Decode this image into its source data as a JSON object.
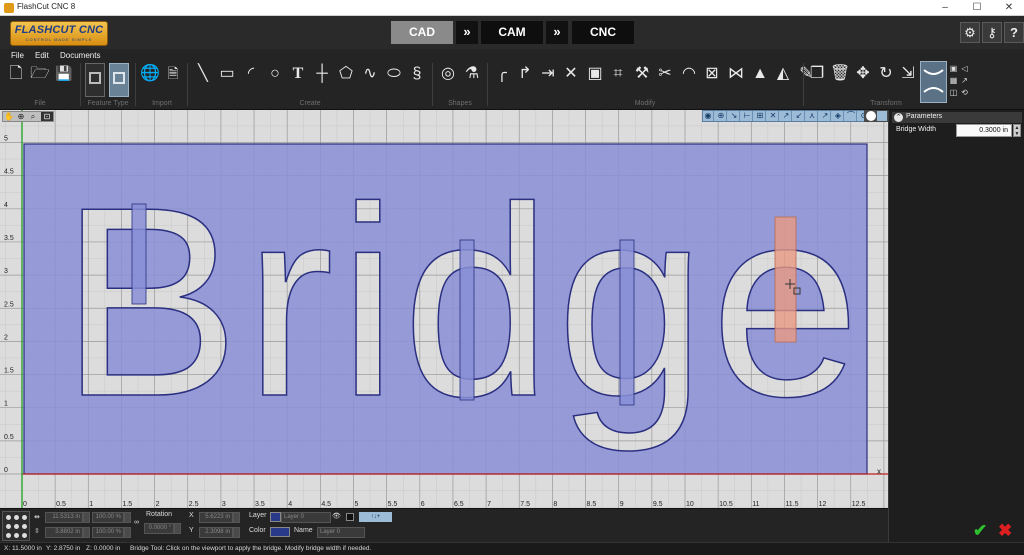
{
  "window": {
    "title": "FlashCut CNC 8",
    "minimize": "–",
    "maximize": "☐",
    "close": "✕"
  },
  "header": {
    "logo_text": "FLASHCUT CNC",
    "logo_tagline": "CONTROL MADE SIMPLE",
    "modes": [
      "CAD",
      "CAM",
      "CNC"
    ],
    "active_mode": "CAD",
    "arrow_glyph": "»",
    "icons": [
      "settings-gear-icon",
      "key-icon",
      "help-icon"
    ]
  },
  "menu": [
    "File",
    "Edit",
    "Documents"
  ],
  "ribbon_groups": {
    "file": "File",
    "feature_type": "Feature Type",
    "import": "Import",
    "create": "Create",
    "shapes": "Shapes",
    "modify": "Modify",
    "transform": "Transform"
  },
  "ribbon_icons": {
    "file": [
      "new-file-icon",
      "open-folder-icon",
      "save-icon"
    ],
    "feature_type": [
      "feature-type-cut-icon",
      "feature-type-selected-icon"
    ],
    "import": [
      "globe-import-icon",
      "file-import-icon"
    ],
    "create": [
      "line-icon",
      "rectangle-icon",
      "arc-icon",
      "circle-icon",
      "text-icon",
      "point-icon",
      "polygon-icon",
      "spline-icon",
      "ellipse-icon",
      "spiral-icon"
    ],
    "shapes": [
      "shape-library-icon",
      "shape-tool-icon"
    ],
    "modify": [
      "fillet-icon",
      "chamfer-icon",
      "extend-icon",
      "trim-icon",
      "image-icon",
      "node-edit-icon",
      "tab-icon",
      "scissors-icon",
      "offset-icon",
      "bridge-icon",
      "join-icon",
      "stamp-icon",
      "gradient-icon",
      "weld-icon"
    ],
    "transform": [
      "copy-icon",
      "delete-icon",
      "move-icon",
      "rotate-icon",
      "mirror-icon",
      "bridge-transform-selected-icon"
    ]
  },
  "canvas": {
    "x_ticks": [
      "0",
      "0.5",
      "1",
      "1.5",
      "2",
      "2.5",
      "3",
      "3.5",
      "4",
      "4.5",
      "5",
      "5.5",
      "6",
      "6.5",
      "7",
      "7.5",
      "8",
      "8.5",
      "9",
      "9.5",
      "10",
      "10.5",
      "11",
      "11.5",
      "12",
      "12.5"
    ],
    "y_ticks": [
      "0",
      "0.5",
      "1",
      "1.5",
      "2",
      "2.5",
      "3",
      "3.5",
      "4",
      "4.5",
      "5"
    ],
    "text_shape": "Bridge",
    "axis_x_end_label": "x",
    "colors": {
      "background": "#dcdcdc",
      "minor_grid": "#c8c8c8",
      "major_grid": "#9a9a9a",
      "stock_fill": "#8a8fd6",
      "stock_stroke": "#2a2f80",
      "bridge_fill": "#e89a82",
      "x_axis": "#c02020",
      "y_axis": "#20a020"
    }
  },
  "snap_tools": [
    "snap-grid-icon",
    "snap-center-icon",
    "snap-endpoint-icon",
    "snap-midpoint-icon",
    "snap-intersection-icon",
    "snap-perpendicular-icon",
    "snap-tangent-icon",
    "snap-nearest-icon",
    "snap-quadrant-icon",
    "snap-angle-icon",
    "snap-node-icon",
    "snap-arc-icon",
    "snap-circle-icon",
    "snap-polar-icon"
  ],
  "parameters": {
    "title": "Parameters",
    "bridge_width_label": "Bridge Width",
    "bridge_width_value": "0.3000 in"
  },
  "properties": {
    "size_w": "11.5313 in",
    "size_h": "3.8802 in",
    "pct_w": "100.00 %",
    "pct_h": "100.00 %",
    "rotation_label": "Rotation",
    "rotation_value": "0.0000 °",
    "x_label": "X",
    "x_value": "5.6223 in",
    "y_label": "Y",
    "y_value": "2.3098 in",
    "layer_label": "Layer",
    "layer_value": "Layer 0",
    "color_label": "Color",
    "name_label": "Name",
    "name_value": "Layer 0"
  },
  "status": {
    "x": "X: 11.5000 in",
    "y": "Y: 2.8750 in",
    "z": "Z: 0.0000 in",
    "message": "Bridge Tool: Click on the viewport to apply the bridge. Modify bridge width if needed."
  },
  "actions": {
    "ok": "✔",
    "cancel": "✖"
  }
}
